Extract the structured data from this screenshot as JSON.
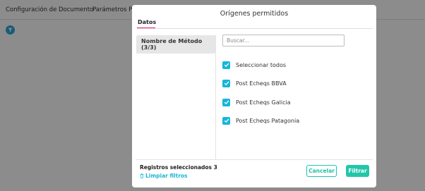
{
  "background": {
    "nav_items": [
      "Configuración de Documento",
      "Parámetros Pú"
    ]
  },
  "modal": {
    "title": "Orígenes permitidos",
    "tab_label": "Datos",
    "method_item": "Nombre de Método (3/3)",
    "search_placeholder": "Buscar...",
    "options": [
      {
        "label": "Seleccionar todos",
        "checked": true
      },
      {
        "label": "Post Echeqs BBVA",
        "checked": true
      },
      {
        "label": "Post Echeqs Galicia",
        "checked": true
      },
      {
        "label": "Post Echeqs Patagonia",
        "checked": true
      }
    ],
    "selected_count_text": "Registros seleccionados 3",
    "clear_filters_label": "Limpiar filtros",
    "cancel_label": "Cancelar",
    "filter_label": "Filtrar"
  },
  "colors": {
    "accent_teal": "#22c7a9",
    "checkbox_blue": "#17b6d9",
    "tab_underline": "#e6247b"
  }
}
